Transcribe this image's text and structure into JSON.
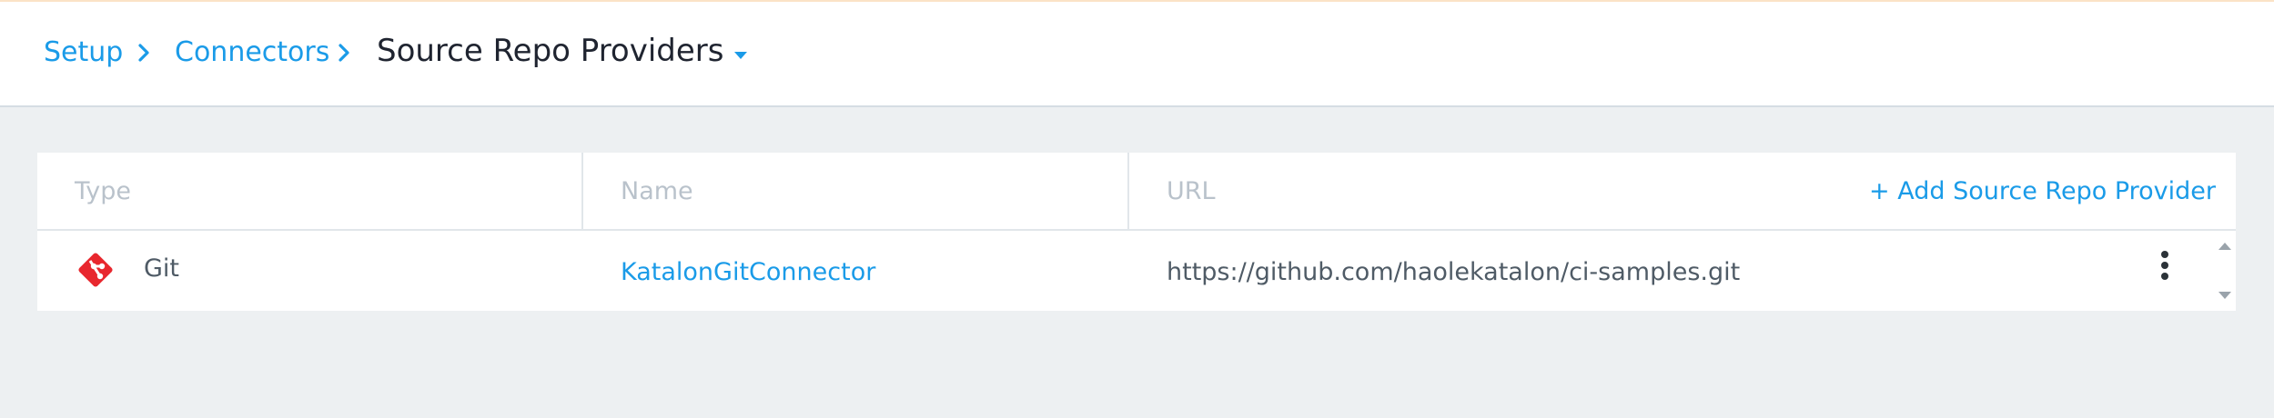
{
  "breadcrumb": {
    "items": [
      "Setup",
      "Connectors"
    ],
    "current": "Source Repo Providers"
  },
  "table": {
    "columns": [
      "Type",
      "Name",
      "URL"
    ],
    "add_label": "+ Add Source Repo Provider",
    "rows": [
      {
        "type": "Git",
        "type_icon": "git-icon",
        "name": "KatalonGitConnector",
        "url": "https://github.com/haolekatalon/ci-samples.git"
      }
    ]
  },
  "colors": {
    "accent": "#1a9be8",
    "git_red": "#e8272e",
    "background": "#edf0f2",
    "header_text": "#b9c2cb",
    "body_text": "#4f5b66"
  },
  "icons": {
    "breadcrumb_separator": "chevron-right-icon",
    "title_dropdown": "caret-down-icon",
    "row_menu": "kebab-menu-icon",
    "scroll_up": "scroll-up-arrow-icon",
    "scroll_down": "scroll-down-arrow-icon"
  }
}
